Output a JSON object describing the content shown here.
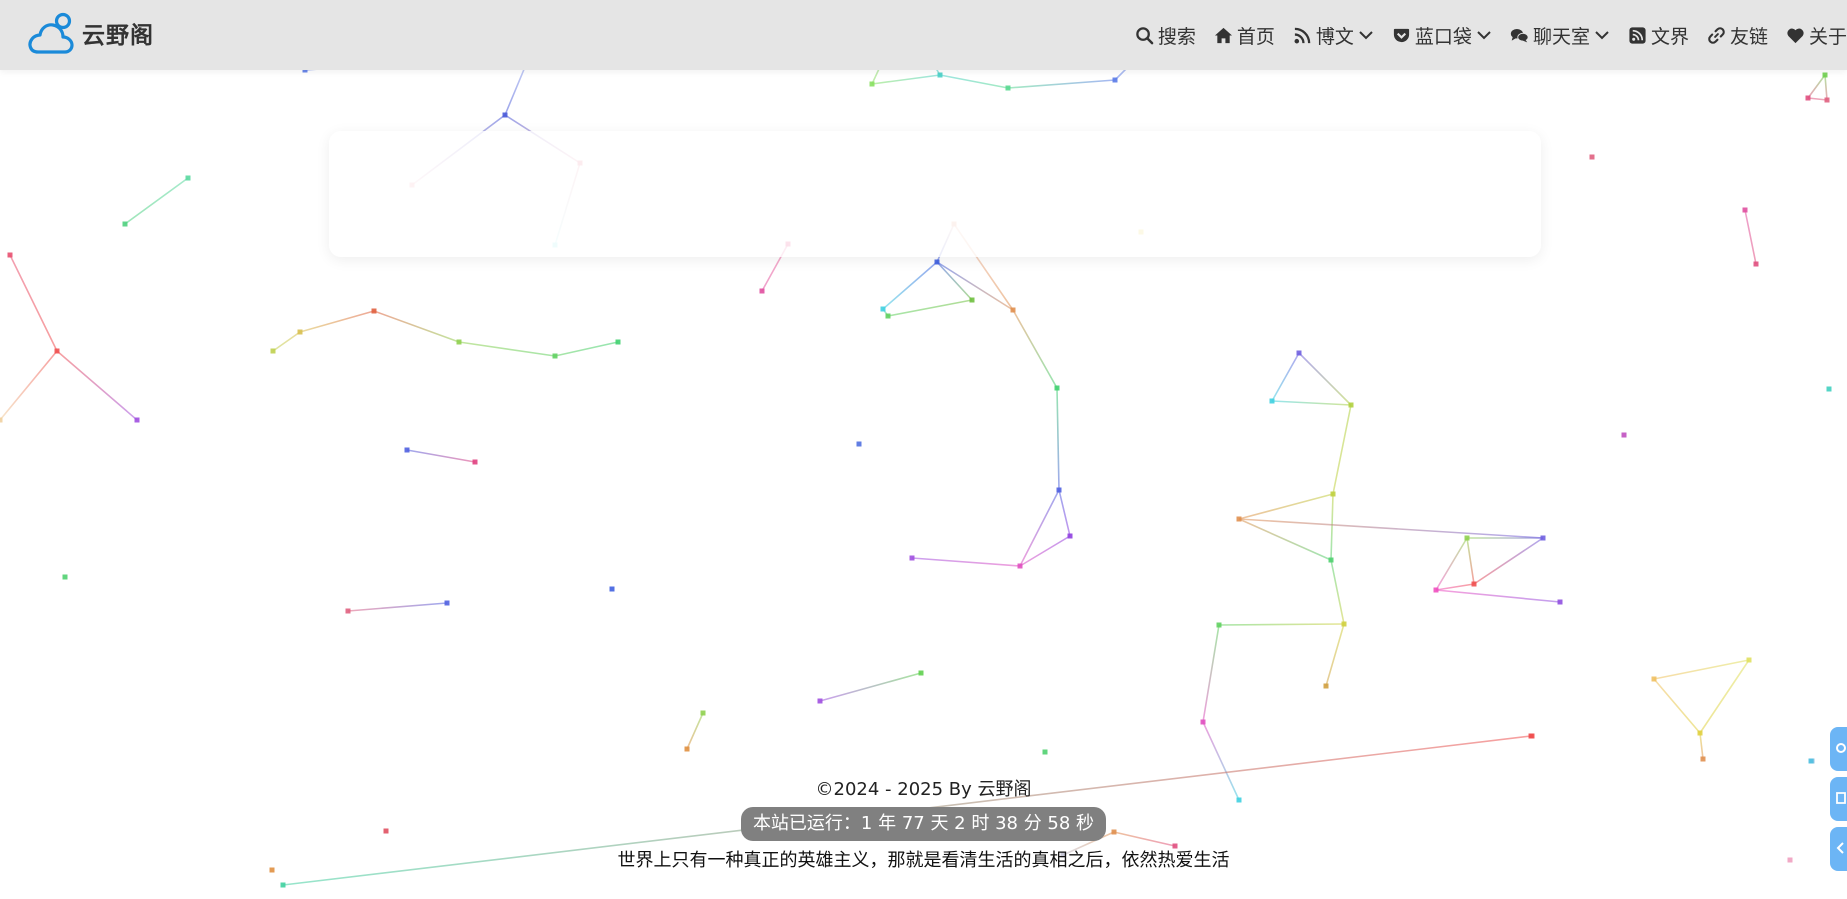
{
  "header": {
    "brand_name": "云野阁",
    "nav": [
      {
        "label": "搜索",
        "icon": "search-icon",
        "has_dropdown": false
      },
      {
        "label": "首页",
        "icon": "home-icon",
        "has_dropdown": false
      },
      {
        "label": "博文",
        "icon": "blog-icon",
        "has_dropdown": true
      },
      {
        "label": "蓝口袋",
        "icon": "pocket-icon",
        "has_dropdown": true
      },
      {
        "label": "聊天室",
        "icon": "chat-icon",
        "has_dropdown": true
      },
      {
        "label": "文界",
        "icon": "rss-icon",
        "has_dropdown": false
      },
      {
        "label": "友链",
        "icon": "link-icon",
        "has_dropdown": false
      },
      {
        "label": "关于",
        "icon": "heart-icon",
        "has_dropdown": false
      }
    ]
  },
  "footer": {
    "copyright": "©2024 - 2025 By 云野阁",
    "runtime": "本站已运行：1 年 77 天 2 时 38 分 58 秒",
    "motto": "世界上只有一种真正的英雄主义，那就是看清生活的真相之后，依然热爱生活"
  },
  "side_buttons": [
    {
      "icon": "settings-icon"
    },
    {
      "icon": "reading-mode-icon"
    },
    {
      "icon": "toggle-sidebar-icon"
    }
  ],
  "colors": {
    "header_bg": "#e5e5e5",
    "accent_blue": "#1a8ad9",
    "side_button": "#6cb5f5",
    "runtime_badge": "#808080"
  }
}
